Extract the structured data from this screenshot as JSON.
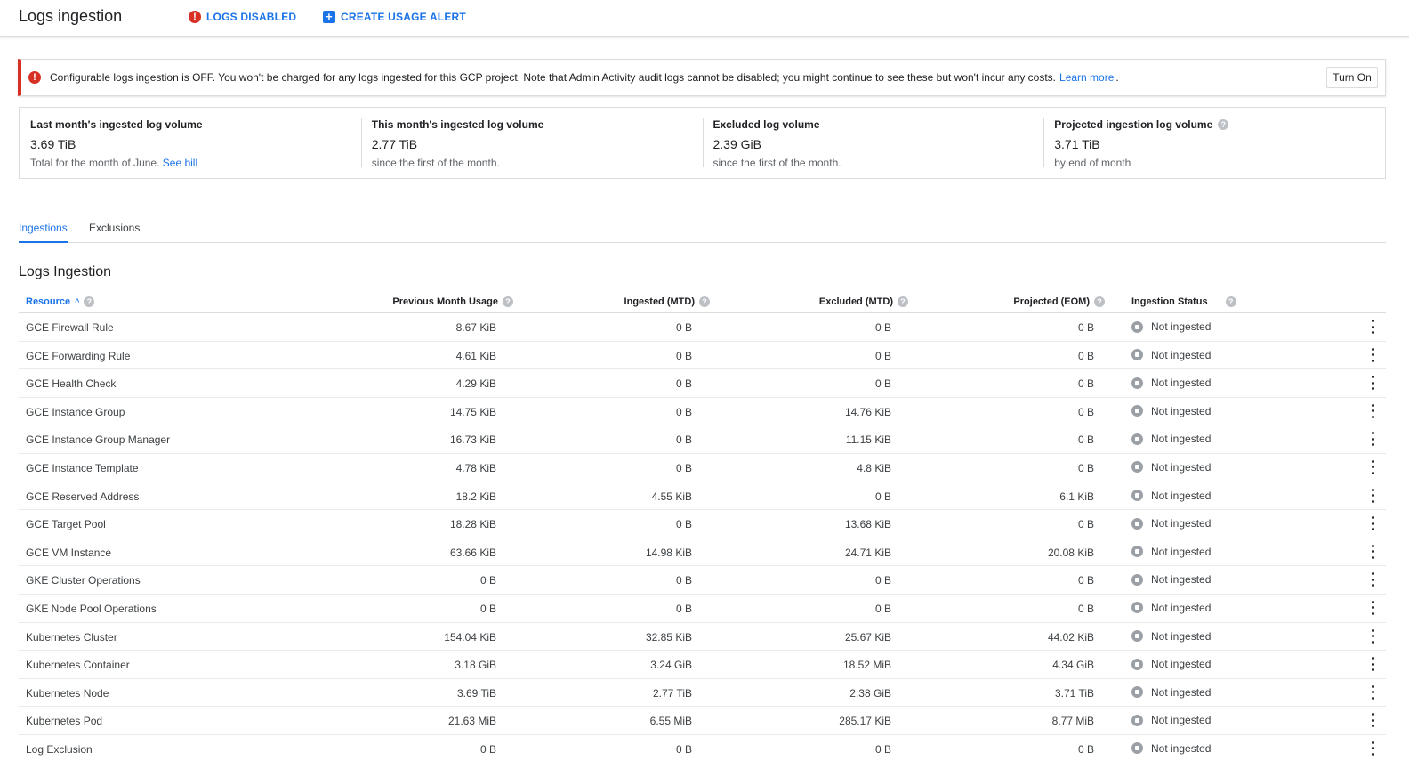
{
  "header": {
    "title": "Logs ingestion",
    "logs_disabled_label": "LOGS DISABLED",
    "create_alert_label": "CREATE USAGE ALERT"
  },
  "banner": {
    "text": "Configurable logs ingestion is OFF. You won't be charged for any logs ingested for this GCP project. Note that Admin Activity audit logs cannot be disabled; you might continue to see these but won't incur any costs.",
    "learn_more": "Learn more",
    "dot": ".",
    "turn_on_label": "Turn On"
  },
  "stats": [
    {
      "title": "Last month's ingested log volume",
      "value": "3.69 TiB",
      "sub": "Total for the month of June.",
      "link": "See bill"
    },
    {
      "title": "This month's ingested log volume",
      "value": "2.77 TiB",
      "sub": "since the first of the month."
    },
    {
      "title": "Excluded log volume",
      "value": "2.39 GiB",
      "sub": "since the first of the month."
    },
    {
      "title": "Projected ingestion log volume",
      "value": "3.71 TiB",
      "sub": "by end of month"
    }
  ],
  "tabs": {
    "ingestions": "Ingestions",
    "exclusions": "Exclusions"
  },
  "section_title": "Logs Ingestion",
  "table": {
    "columns": {
      "resource": "Resource",
      "previous": "Previous Month Usage",
      "ingested": "Ingested (MTD)",
      "excluded": "Excluded (MTD)",
      "projected": "Projected (EOM)",
      "status": "Ingestion Status"
    },
    "rows": [
      {
        "resource": "GCE Firewall Rule",
        "previous": "8.67 KiB",
        "ingested": "0 B",
        "excluded": "0 B",
        "projected": "0 B",
        "status": "Not ingested"
      },
      {
        "resource": "GCE Forwarding Rule",
        "previous": "4.61 KiB",
        "ingested": "0 B",
        "excluded": "0 B",
        "projected": "0 B",
        "status": "Not ingested"
      },
      {
        "resource": "GCE Health Check",
        "previous": "4.29 KiB",
        "ingested": "0 B",
        "excluded": "0 B",
        "projected": "0 B",
        "status": "Not ingested"
      },
      {
        "resource": "GCE Instance Group",
        "previous": "14.75 KiB",
        "ingested": "0 B",
        "excluded": "14.76 KiB",
        "projected": "0 B",
        "status": "Not ingested"
      },
      {
        "resource": "GCE Instance Group Manager",
        "previous": "16.73 KiB",
        "ingested": "0 B",
        "excluded": "11.15 KiB",
        "projected": "0 B",
        "status": "Not ingested"
      },
      {
        "resource": "GCE Instance Template",
        "previous": "4.78 KiB",
        "ingested": "0 B",
        "excluded": "4.8 KiB",
        "projected": "0 B",
        "status": "Not ingested"
      },
      {
        "resource": "GCE Reserved Address",
        "previous": "18.2 KiB",
        "ingested": "4.55 KiB",
        "excluded": "0 B",
        "projected": "6.1 KiB",
        "status": "Not ingested"
      },
      {
        "resource": "GCE Target Pool",
        "previous": "18.28 KiB",
        "ingested": "0 B",
        "excluded": "13.68 KiB",
        "projected": "0 B",
        "status": "Not ingested"
      },
      {
        "resource": "GCE VM Instance",
        "previous": "63.66 KiB",
        "ingested": "14.98 KiB",
        "excluded": "24.71 KiB",
        "projected": "20.08 KiB",
        "status": "Not ingested"
      },
      {
        "resource": "GKE Cluster Operations",
        "previous": "0 B",
        "ingested": "0 B",
        "excluded": "0 B",
        "projected": "0 B",
        "status": "Not ingested"
      },
      {
        "resource": "GKE Node Pool Operations",
        "previous": "0 B",
        "ingested": "0 B",
        "excluded": "0 B",
        "projected": "0 B",
        "status": "Not ingested"
      },
      {
        "resource": "Kubernetes Cluster",
        "previous": "154.04 KiB",
        "ingested": "32.85 KiB",
        "excluded": "25.67 KiB",
        "projected": "44.02 KiB",
        "status": "Not ingested"
      },
      {
        "resource": "Kubernetes Container",
        "previous": "3.18 GiB",
        "ingested": "3.24 GiB",
        "excluded": "18.52 MiB",
        "projected": "4.34 GiB",
        "status": "Not ingested"
      },
      {
        "resource": "Kubernetes Node",
        "previous": "3.69 TiB",
        "ingested": "2.77 TiB",
        "excluded": "2.38 GiB",
        "projected": "3.71 TiB",
        "status": "Not ingested"
      },
      {
        "resource": "Kubernetes Pod",
        "previous": "21.63 MiB",
        "ingested": "6.55 MiB",
        "excluded": "285.17 KiB",
        "projected": "8.77 MiB",
        "status": "Not ingested"
      },
      {
        "resource": "Log Exclusion",
        "previous": "0 B",
        "ingested": "0 B",
        "excluded": "0 B",
        "projected": "0 B",
        "status": "Not ingested"
      }
    ]
  },
  "colors": {
    "accent": "#1a73e8",
    "error": "#d93025",
    "status_icon": "#9aa0a6"
  }
}
